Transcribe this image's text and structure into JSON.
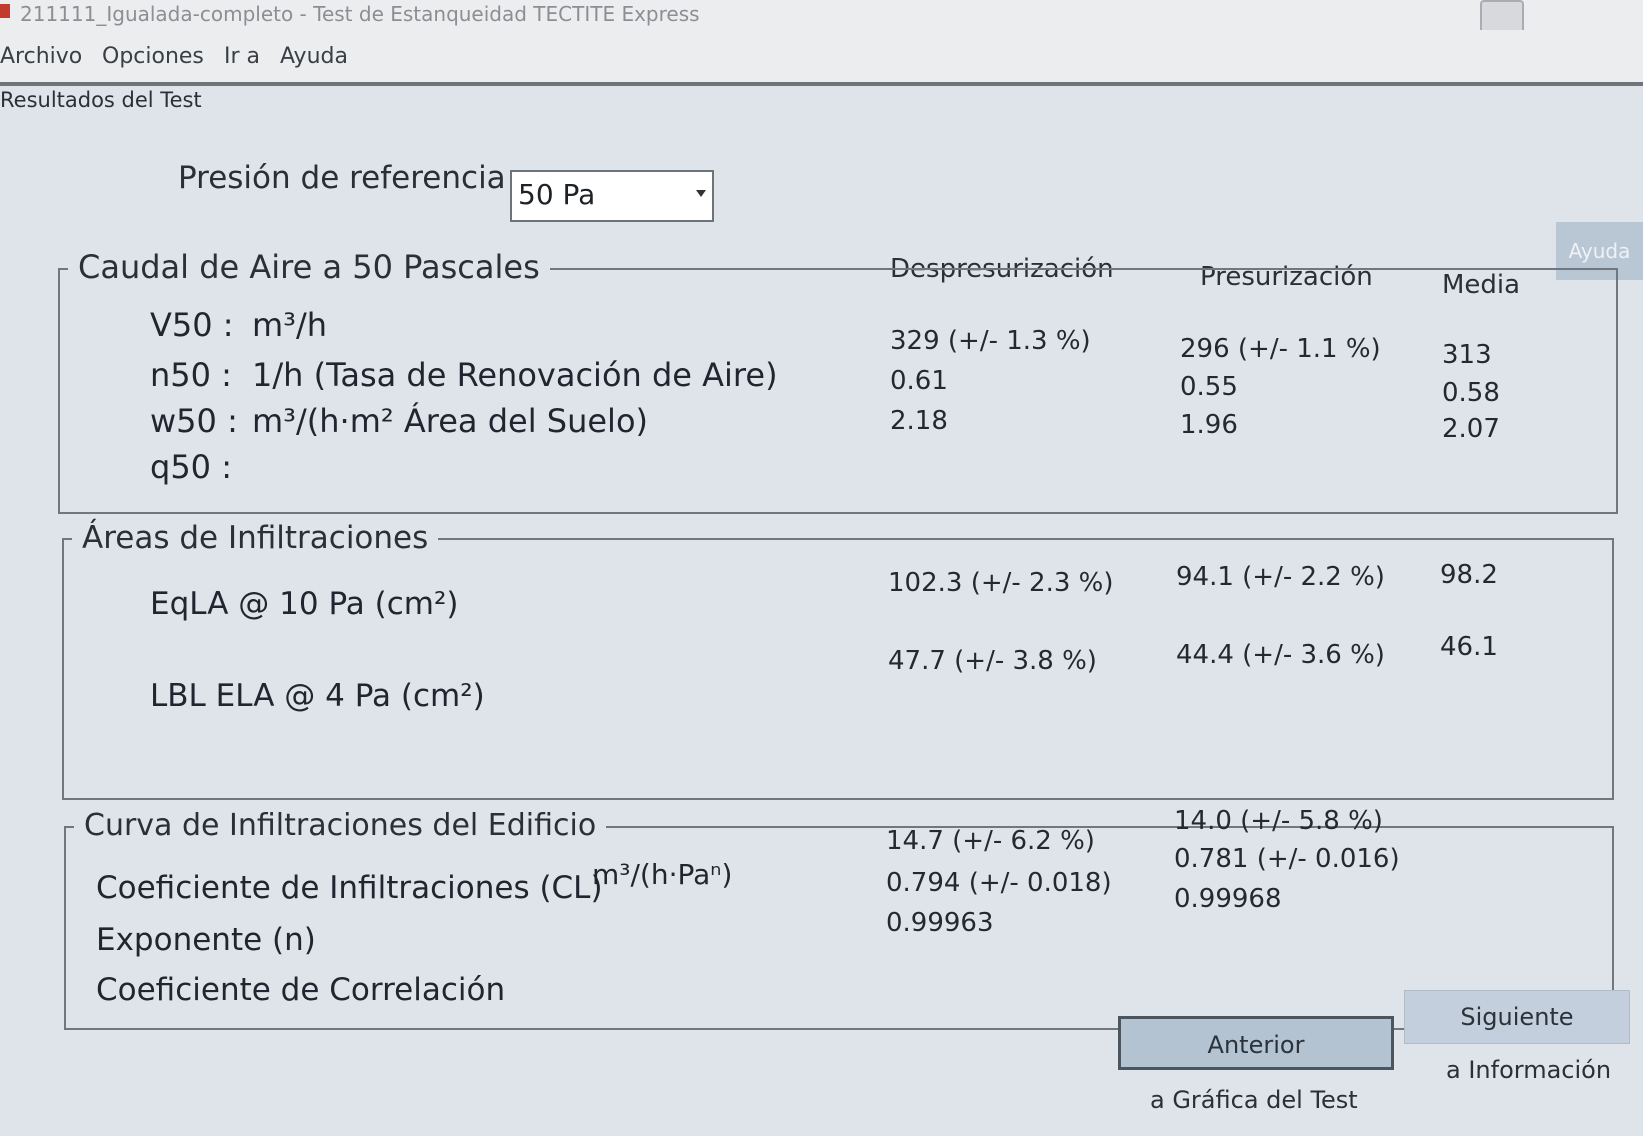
{
  "window": {
    "title": "211111_Igualada-completo - Test de Estanqueidad TECTITE Express"
  },
  "menu": [
    "Archivo",
    "Opciones",
    "Ir a",
    "Ayuda"
  ],
  "section_title": "Resultados del Test",
  "reference": {
    "label": "Presión de referencia",
    "value": "50 Pa"
  },
  "help_button": "Ayuda",
  "columns": {
    "depress": "Despresurización",
    "press": "Presurización",
    "mean": "Media"
  },
  "airflow": {
    "title": "Caudal de Aire a 50 Pascales",
    "rows": [
      {
        "symbol": "V50 :",
        "unit": "m³/h",
        "depress": "329  (+/- 1.3 %)",
        "press": "296  (+/- 1.1 %)",
        "mean": "313"
      },
      {
        "symbol": "n50 :",
        "unit": "1/h (Tasa de Renovación de Aire)",
        "depress": "0.61",
        "press": "0.55",
        "mean": "0.58"
      },
      {
        "symbol": "w50 :",
        "unit": "m³/(h·m² Área del Suelo)",
        "depress": "2.18",
        "press": "1.96",
        "mean": "2.07"
      },
      {
        "symbol": "q50 :",
        "unit": "",
        "depress": "",
        "press": "",
        "mean": ""
      }
    ]
  },
  "leakage": {
    "title": "Áreas de Infiltraciones",
    "rows": [
      {
        "label": "EqLA @ 10 Pa (cm²)",
        "depress": "102.3 (+/- 2.3 %)",
        "press": "94.1 (+/- 2.2 %)",
        "mean": "98.2"
      },
      {
        "label": "LBL ELA @ 4 Pa (cm²)",
        "depress": "47.7 (+/- 3.8 %)",
        "press": "44.4 (+/- 3.6 %)",
        "mean": "46.1"
      }
    ]
  },
  "curve": {
    "title": "Curva de Infiltraciones del Edificio",
    "unit": "m³/(h·Paⁿ)",
    "rows": [
      {
        "label": "Coeficiente de Infiltraciones (CL)",
        "depress": "14.7 (+/- 6.2 %)",
        "press": "14.0 (+/- 5.8 %)"
      },
      {
        "label": "Exponente (n)",
        "depress": "0.794 (+/- 0.018)",
        "press": "0.781 (+/- 0.016)"
      },
      {
        "label": "Coeficiente de Correlación",
        "depress": "0.99963",
        "press": "0.99968"
      }
    ]
  },
  "navigation": {
    "prev_label": "Anterior",
    "prev_caption": "a Gráfica del Test",
    "next_label": "Siguiente",
    "next_caption": "a Información"
  }
}
